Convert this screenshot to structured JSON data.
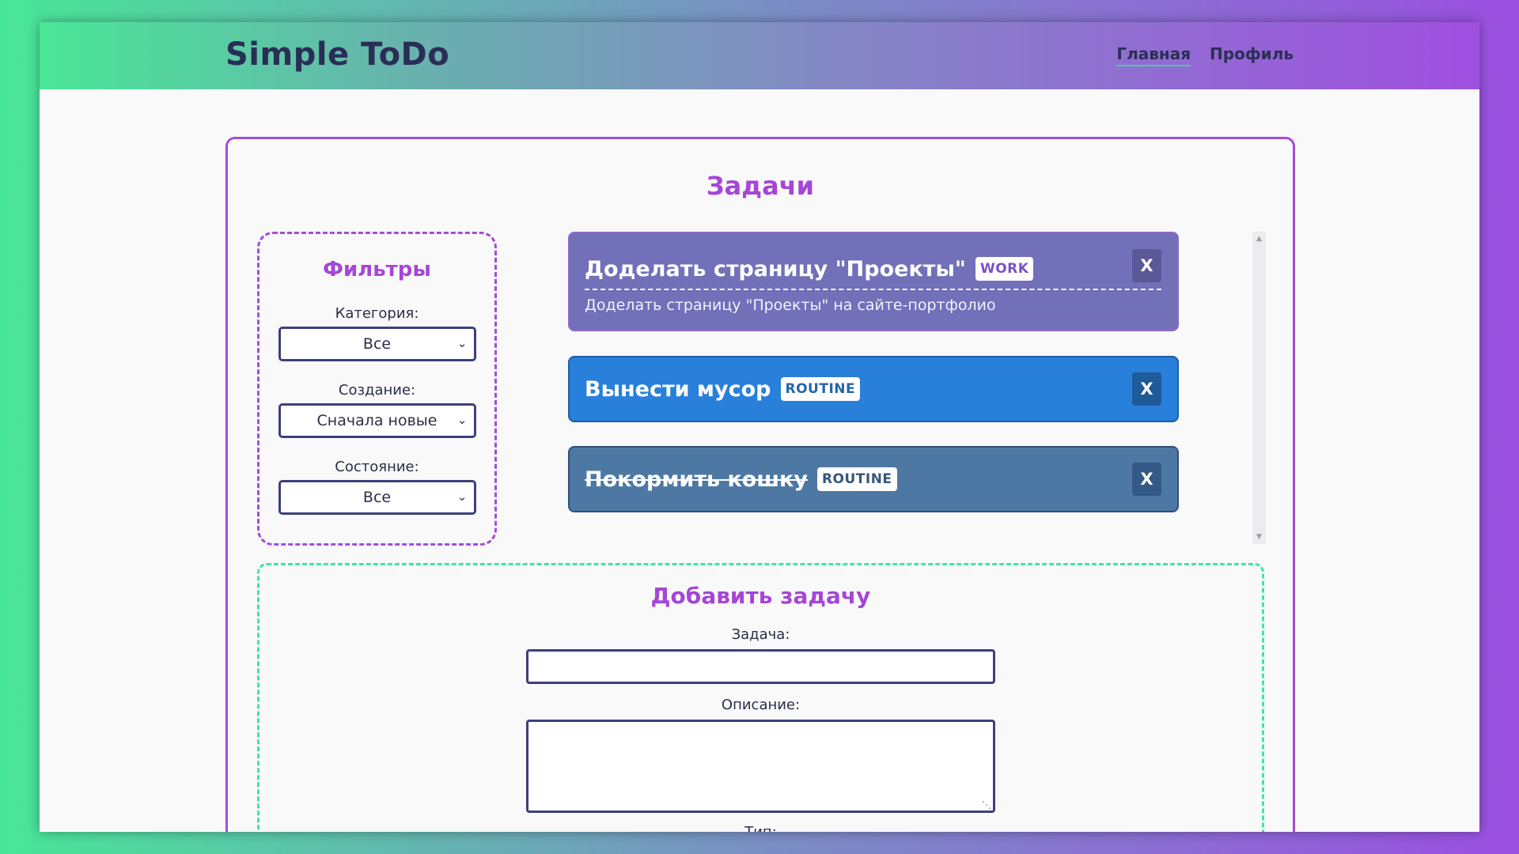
{
  "header": {
    "app_title": "Simple ToDo",
    "nav": [
      {
        "label": "Главная",
        "active": true
      },
      {
        "label": "Профиль",
        "active": false
      }
    ]
  },
  "main": {
    "title": "Задачи",
    "filters": {
      "title": "Фильтры",
      "category": {
        "label": "Категория:",
        "value": "Все"
      },
      "created": {
        "label": "Создание:",
        "value": "Сначала новые"
      },
      "state": {
        "label": "Состояние:",
        "value": "Все"
      }
    },
    "tasks": [
      {
        "title": "Доделать страницу \"Проекты\"",
        "badge": "WORK",
        "description": "Доделать страницу \"Проекты\" на сайте-портфолио",
        "done": false,
        "color": "#7270b8",
        "close_label": "X"
      },
      {
        "title": "Вынести мусор",
        "badge": "ROUTINE",
        "done": false,
        "color": "#2880da",
        "close_label": "X"
      },
      {
        "title": "Покормить кошку",
        "badge": "ROUTINE",
        "done": true,
        "color": "#4e78a4",
        "close_label": "X"
      }
    ],
    "add_task": {
      "title": "Добавить задачу",
      "task_label": "Задача:",
      "task_value": "",
      "description_label": "Описание:",
      "description_value": "",
      "type_label": "Тип:"
    }
  },
  "colors": {
    "accent_purple": "#a546d6",
    "accent_green": "#43e3a2",
    "text_dark": "#2b2f55"
  }
}
